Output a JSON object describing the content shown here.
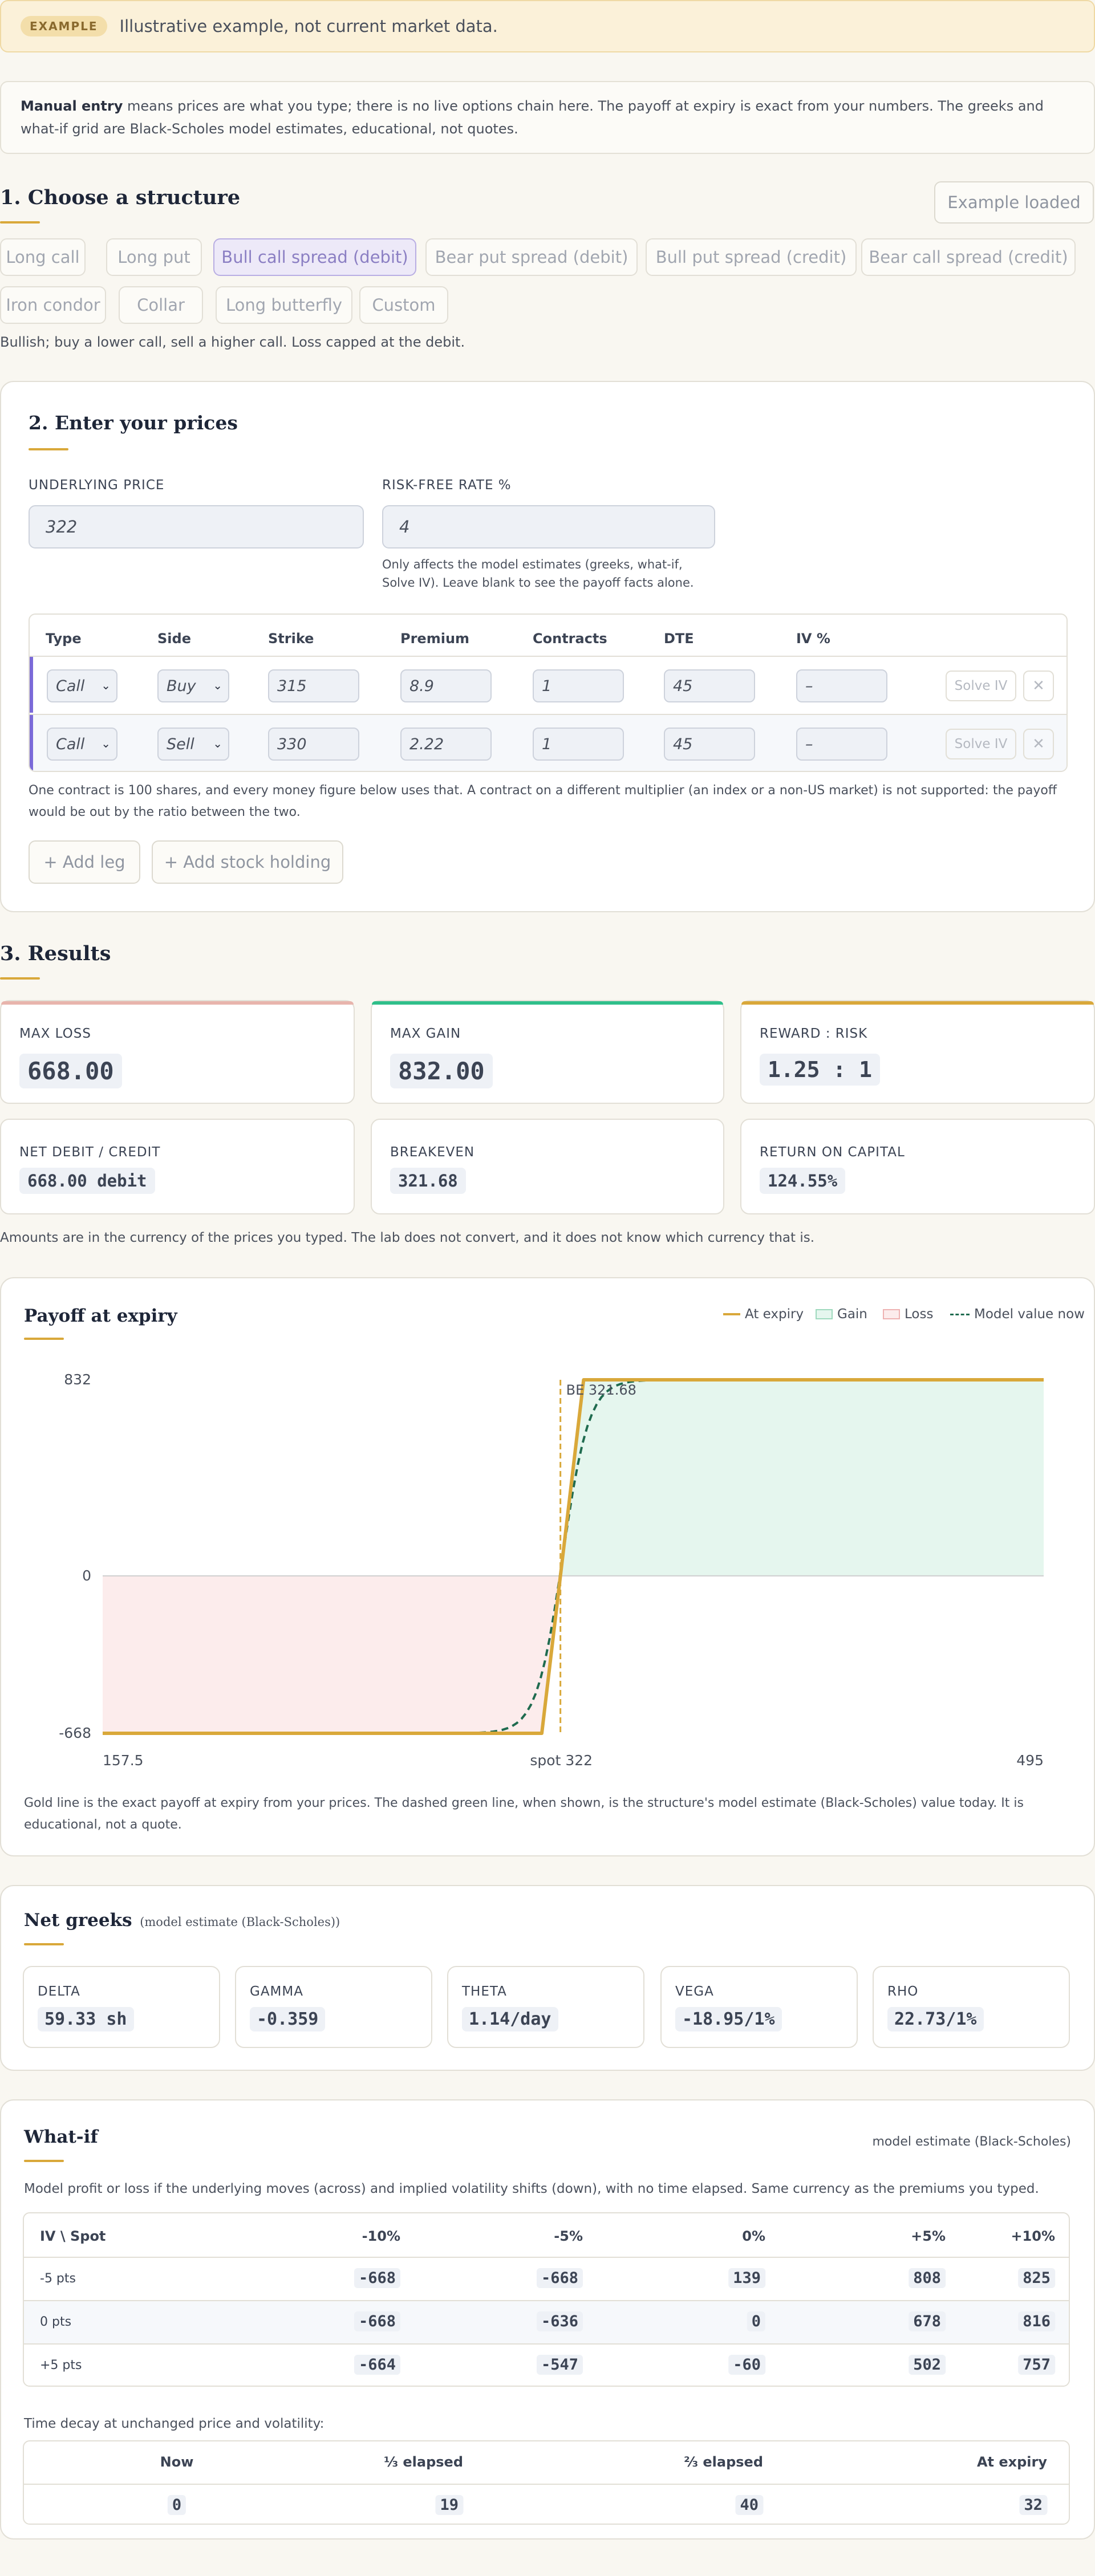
{
  "banner": {
    "badge": "EXAMPLE",
    "text": "Illustrative example, not current market data."
  },
  "info": {
    "bold": "Manual entry",
    "rest": " means prices are what you type; there is no live options chain here. The payoff at expiry is exact from your numbers. The greeks and what-if grid are Black-Scholes model estimates, educational, not quotes."
  },
  "structure": {
    "title": "1. Choose a structure",
    "example_button": "Example loaded",
    "options": [
      "Long call",
      "Long put",
      "Bull call spread (debit)",
      "Bear put spread (debit)",
      "Bull put spread (credit)",
      "Bear call spread (credit)",
      "Iron condor",
      "Collar",
      "Long butterfly",
      "Custom"
    ],
    "active_index": 2,
    "description": "Bullish; buy a lower call, sell a higher call. Loss capped at the debit."
  },
  "prices": {
    "title": "2. Enter your prices",
    "underlying_label": "UNDERLYING PRICE",
    "underlying_value": "322",
    "rate_label": "RISK-FREE RATE %",
    "rate_value": "4",
    "rate_note": "Only affects the model estimates (greeks, what-if, Solve IV). Leave blank to see the payoff facts alone.",
    "headers": [
      "Type",
      "Side",
      "Strike",
      "Premium",
      "Contracts",
      "DTE",
      "IV %"
    ],
    "legs": [
      {
        "type": "Call",
        "side": "Buy",
        "strike": "315",
        "premium": "8.9",
        "contracts": "1",
        "dte": "45",
        "iv": "–"
      },
      {
        "type": "Call",
        "side": "Sell",
        "strike": "330",
        "premium": "2.22",
        "contracts": "1",
        "dte": "45",
        "iv": "–"
      }
    ],
    "solve_label": "Solve IV",
    "remove_symbol": "✕",
    "contract_note": "One contract is 100 shares, and every money figure below uses that. A contract on a different multiplier (an index or a non-US market) is not supported: the payoff would be out by the ratio between the two.",
    "add_leg": "+ Add leg",
    "add_stock": "+ Add stock holding"
  },
  "results": {
    "title": "3. Results",
    "metrics": [
      {
        "label": "MAX LOSS",
        "value": "668.00",
        "accent": "#e8b4ac"
      },
      {
        "label": "MAX GAIN",
        "value": "832.00",
        "accent": "#2fbf8a"
      },
      {
        "label": "REWARD : RISK",
        "value": "1.25 : 1",
        "accent": "#d9a83a"
      },
      {
        "label": "NET DEBIT / CREDIT",
        "value": "668.00 debit"
      },
      {
        "label": "BREAKEVEN",
        "value": "321.68"
      },
      {
        "label": "RETURN ON CAPITAL",
        "value": "124.55%"
      }
    ],
    "currency_note": "Amounts are in the currency of the prices you typed. The lab does not convert, and it does not know which currency that is."
  },
  "payoff": {
    "title": "Payoff at expiry",
    "legend": {
      "expiry": "At expiry",
      "gain": "Gain",
      "loss": "Loss",
      "model": "Model value now"
    },
    "breakeven_label": "BE 321.68",
    "spot_label": "spot 322",
    "note": "Gold line is the exact payoff at expiry from your prices. The dashed green line, when shown, is the structure's model estimate (Black-Scholes) value today. It is educational, not a quote."
  },
  "chart_data": {
    "type": "line",
    "x_range": [
      157.5,
      495
    ],
    "y_range": [
      -668,
      832
    ],
    "x_ticks": [
      "157.5",
      "495"
    ],
    "y_ticks": [
      "832",
      "0",
      "-668"
    ],
    "series": [
      {
        "name": "At expiry",
        "x": [
          157.5,
          315,
          330,
          495
        ],
        "y": [
          -668,
          -668,
          832,
          832
        ]
      }
    ],
    "breakeven": 321.68,
    "spot": 322,
    "colors": {
      "expiry": "#d9a83a",
      "model": "#1f6b4f",
      "gain": "#e5f6ee",
      "loss": "#fcecec"
    }
  },
  "greeks": {
    "title": "Net greeks",
    "subtitle": "(model estimate (Black-Scholes))",
    "items": [
      {
        "label": "DELTA",
        "value": "59.33 sh"
      },
      {
        "label": "GAMMA",
        "value": "-0.359"
      },
      {
        "label": "THETA",
        "value": "1.14/day"
      },
      {
        "label": "VEGA",
        "value": "-18.95/1%"
      },
      {
        "label": "RHO",
        "value": "22.73/1%"
      }
    ]
  },
  "whatif": {
    "title": "What-if",
    "tag": "model estimate (Black-Scholes)",
    "note": "Model profit or loss if the underlying moves (across) and implied volatility shifts (down), with no time elapsed. Same currency as the premiums you typed.",
    "corner": "IV \\ Spot",
    "columns": [
      "-10%",
      "-5%",
      "0%",
      "+5%",
      "+10%"
    ],
    "rows": [
      {
        "label": "-5 pts",
        "values": [
          "-668",
          "-668",
          "139",
          "808",
          "825"
        ]
      },
      {
        "label": "0 pts",
        "values": [
          "-668",
          "-636",
          "0",
          "678",
          "816"
        ]
      },
      {
        "label": "+5 pts",
        "values": [
          "-664",
          "-547",
          "-60",
          "502",
          "757"
        ]
      }
    ],
    "decay_note": "Time decay at unchanged price and volatility:",
    "decay_headers": [
      "Now",
      "⅓ elapsed",
      "⅔ elapsed",
      "At expiry"
    ],
    "decay_values": [
      "0",
      "19",
      "40",
      "32"
    ]
  }
}
